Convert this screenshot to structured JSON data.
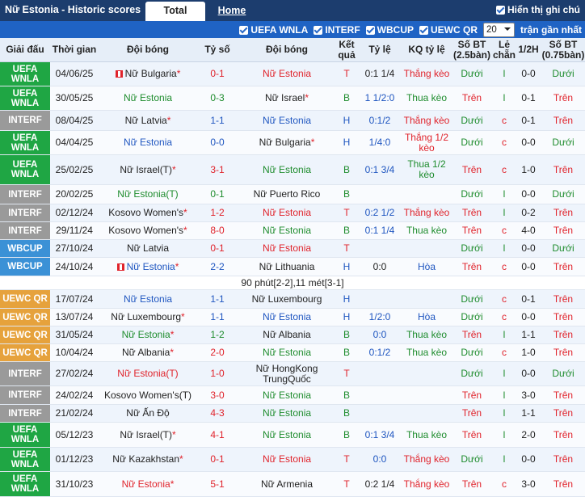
{
  "header": {
    "title": "Nữ Estonia - Historic scores",
    "tab_total": "Total",
    "tab_home": "Home",
    "show_notes_label": "Hiển thị ghi chú"
  },
  "filters": {
    "items": [
      "UEFA WNLA",
      "INTERF",
      "WBCUP",
      "UEWC QR"
    ],
    "count_value": "20",
    "recent_label": "trận gần nhất"
  },
  "columns": [
    "Giải đấu",
    "Thời gian",
    "Đội bóng",
    "Tỷ số",
    "Đội bóng",
    "Kết quả",
    "Tỷ lệ",
    "KQ tỷ lệ",
    "Số BT (2.5bàn)",
    "Lẻ chẵn",
    "1/2H",
    "Số BT (0.75bàn)"
  ],
  "colors": {
    "win": "#e0232b",
    "draw": "#1f56c0",
    "lose": "#1e8c2d",
    "uefa": "#1fa644",
    "interf": "#9a9a9a",
    "wbcup": "#3b91d6",
    "uewc": "#e6a23c"
  },
  "rows": [
    {
      "league": "UEFA WNLA",
      "lc": "UEFA",
      "date": "04/06/25",
      "home": "Nữ Bulgaria",
      "home_ast": "*",
      "home_flag": true,
      "hc": "",
      "score": "0-1",
      "sc": "red",
      "away": "Nữ Estonia",
      "away_ast": "",
      "away_flag": false,
      "ac": "red",
      "res": "T",
      "rc": "red",
      "hcap": "0:1 1/4",
      "hcapc": "",
      "kq": "Thắng kèo",
      "kqc": "red",
      "ou": "Dưới",
      "ouc": "green",
      "oe": "l",
      "oec": "green",
      "half": "0-0",
      "ou2": "Dưới",
      "ou2c": "green"
    },
    {
      "league": "UEFA WNLA",
      "lc": "UEFA",
      "date": "30/05/25",
      "home": "Nữ Estonia",
      "home_ast": "",
      "home_flag": false,
      "hc": "green",
      "score": "0-3",
      "sc": "green",
      "away": "Nữ Israel",
      "away_ast": "*",
      "away_flag": false,
      "ac": "",
      "res": "B",
      "rc": "green",
      "hcap": "1 1/2:0",
      "hcapc": "blue",
      "kq": "Thua kèo",
      "kqc": "green",
      "ou": "Trên",
      "ouc": "red",
      "oe": "l",
      "oec": "green",
      "half": "0-1",
      "ou2": "Trên",
      "ou2c": "red"
    },
    {
      "league": "INTERF",
      "lc": "INTERF",
      "date": "08/04/25",
      "home": "Nữ Latvia",
      "home_ast": "*",
      "home_flag": false,
      "hc": "",
      "score": "1-1",
      "sc": "blue",
      "away": "Nữ Estonia",
      "away_ast": "",
      "away_flag": false,
      "ac": "blue",
      "res": "H",
      "rc": "blue",
      "hcap": "0:1/2",
      "hcapc": "blue",
      "kq": "Thắng kèo",
      "kqc": "red",
      "ou": "Dưới",
      "ouc": "green",
      "oe": "c",
      "oec": "red",
      "half": "0-1",
      "ou2": "Trên",
      "ou2c": "red"
    },
    {
      "league": "UEFA WNLA",
      "lc": "UEFA",
      "date": "04/04/25",
      "home": "Nữ Estonia",
      "home_ast": "",
      "home_flag": false,
      "hc": "blue",
      "score": "0-0",
      "sc": "blue",
      "away": "Nữ Bulgaria",
      "away_ast": "*",
      "away_flag": false,
      "ac": "",
      "res": "H",
      "rc": "blue",
      "hcap": "1/4:0",
      "hcapc": "blue",
      "kq": "Thắng 1/2 kèo",
      "kqc": "red",
      "ou": "Dưới",
      "ouc": "green",
      "oe": "c",
      "oec": "red",
      "half": "0-0",
      "ou2": "Dưới",
      "ou2c": "green"
    },
    {
      "league": "UEFA WNLA",
      "lc": "UEFA",
      "date": "25/02/25",
      "home": "Nữ Israel(T)",
      "home_ast": "*",
      "home_flag": false,
      "hc": "",
      "score": "3-1",
      "sc": "red",
      "away": "Nữ Estonia",
      "away_ast": "",
      "away_flag": false,
      "ac": "green",
      "res": "B",
      "rc": "green",
      "hcap": "0:1 3/4",
      "hcapc": "blue",
      "kq": "Thua 1/2 kèo",
      "kqc": "green",
      "ou": "Trên",
      "ouc": "red",
      "oe": "c",
      "oec": "red",
      "half": "1-0",
      "ou2": "Trên",
      "ou2c": "red"
    },
    {
      "league": "INTERF",
      "lc": "INTERF",
      "date": "20/02/25",
      "home": "Nữ Estonia(T)",
      "home_ast": "",
      "home_flag": false,
      "hc": "green",
      "score": "0-1",
      "sc": "green",
      "away": "Nữ Puerto Rico",
      "away_ast": "",
      "away_flag": false,
      "ac": "",
      "res": "B",
      "rc": "green",
      "hcap": "",
      "hcapc": "",
      "kq": "",
      "kqc": "",
      "ou": "Dưới",
      "ouc": "green",
      "oe": "l",
      "oec": "green",
      "half": "0-0",
      "ou2": "Dưới",
      "ou2c": "green"
    },
    {
      "league": "INTERF",
      "lc": "INTERF",
      "date": "02/12/24",
      "home": "Kosovo Women's",
      "home_ast": "*",
      "home_flag": false,
      "hc": "",
      "score": "1-2",
      "sc": "red",
      "away": "Nữ Estonia",
      "away_ast": "",
      "away_flag": false,
      "ac": "red",
      "res": "T",
      "rc": "red",
      "hcap": "0:2 1/2",
      "hcapc": "blue",
      "kq": "Thắng kèo",
      "kqc": "red",
      "ou": "Trên",
      "ouc": "red",
      "oe": "l",
      "oec": "green",
      "half": "0-2",
      "ou2": "Trên",
      "ou2c": "red"
    },
    {
      "league": "INTERF",
      "lc": "INTERF",
      "date": "29/11/24",
      "home": "Kosovo Women's",
      "home_ast": "*",
      "home_flag": false,
      "hc": "",
      "score": "8-0",
      "sc": "red",
      "away": "Nữ Estonia",
      "away_ast": "",
      "away_flag": false,
      "ac": "green",
      "res": "B",
      "rc": "green",
      "hcap": "0:1 1/4",
      "hcapc": "blue",
      "kq": "Thua kèo",
      "kqc": "green",
      "ou": "Trên",
      "ouc": "red",
      "oe": "c",
      "oec": "red",
      "half": "4-0",
      "ou2": "Trên",
      "ou2c": "red"
    },
    {
      "league": "WBCUP",
      "lc": "WBCUP",
      "date": "27/10/24",
      "home": "Nữ Latvia",
      "home_ast": "",
      "home_flag": false,
      "hc": "",
      "score": "0-1",
      "sc": "red",
      "away": "Nữ Estonia",
      "away_ast": "",
      "away_flag": false,
      "ac": "red",
      "res": "T",
      "rc": "red",
      "hcap": "",
      "hcapc": "",
      "kq": "",
      "kqc": "",
      "ou": "Dưới",
      "ouc": "green",
      "oe": "l",
      "oec": "green",
      "half": "0-0",
      "ou2": "Dưới",
      "ou2c": "green"
    },
    {
      "league": "WBCUP",
      "lc": "WBCUP",
      "date": "24/10/24",
      "home": "Nữ Estonia",
      "home_ast": "*",
      "home_flag": true,
      "hc": "blue",
      "score": "2-2",
      "sc": "blue",
      "away": "Nữ Lithuania",
      "away_ast": "",
      "away_flag": false,
      "ac": "",
      "res": "H",
      "rc": "blue",
      "hcap": "0:0",
      "hcapc": "",
      "kq": "Hòa",
      "kqc": "blue",
      "ou": "Trên",
      "ouc": "red",
      "oe": "c",
      "oec": "red",
      "half": "0-0",
      "ou2": "Trên",
      "ou2c": "red"
    },
    {
      "note": "90 phút[2-2],11 mét[3-1]"
    },
    {
      "league": "UEWC QR",
      "lc": "UEWC",
      "date": "17/07/24",
      "home": "Nữ Estonia",
      "home_ast": "",
      "home_flag": false,
      "hc": "blue",
      "score": "1-1",
      "sc": "blue",
      "away": "Nữ Luxembourg",
      "away_ast": "",
      "away_flag": false,
      "ac": "",
      "res": "H",
      "rc": "blue",
      "hcap": "",
      "hcapc": "",
      "kq": "",
      "kqc": "",
      "ou": "Dưới",
      "ouc": "green",
      "oe": "c",
      "oec": "red",
      "half": "0-1",
      "ou2": "Trên",
      "ou2c": "red"
    },
    {
      "league": "UEWC QR",
      "lc": "UEWC",
      "date": "13/07/24",
      "home": "Nữ Luxembourg",
      "home_ast": "*",
      "home_flag": false,
      "hc": "",
      "score": "1-1",
      "sc": "blue",
      "away": "Nữ Estonia",
      "away_ast": "",
      "away_flag": false,
      "ac": "blue",
      "res": "H",
      "rc": "blue",
      "hcap": "1/2:0",
      "hcapc": "blue",
      "kq": "Hòa",
      "kqc": "blue",
      "ou": "Dưới",
      "ouc": "green",
      "oe": "c",
      "oec": "red",
      "half": "0-0",
      "ou2": "Trên",
      "ou2c": "red"
    },
    {
      "league": "UEWC QR",
      "lc": "UEWC",
      "date": "31/05/24",
      "home": "Nữ Estonia",
      "home_ast": "*",
      "home_flag": false,
      "hc": "green",
      "score": "1-2",
      "sc": "green",
      "away": "Nữ Albania",
      "away_ast": "",
      "away_flag": false,
      "ac": "",
      "res": "B",
      "rc": "green",
      "hcap": "0:0",
      "hcapc": "blue",
      "kq": "Thua kèo",
      "kqc": "green",
      "ou": "Trên",
      "ouc": "red",
      "oe": "l",
      "oec": "green",
      "half": "1-1",
      "ou2": "Trên",
      "ou2c": "red"
    },
    {
      "league": "UEWC QR",
      "lc": "UEWC",
      "date": "10/04/24",
      "home": "Nữ Albania",
      "home_ast": "*",
      "home_flag": false,
      "hc": "",
      "score": "2-0",
      "sc": "red",
      "away": "Nữ Estonia",
      "away_ast": "",
      "away_flag": false,
      "ac": "green",
      "res": "B",
      "rc": "green",
      "hcap": "0:1/2",
      "hcapc": "blue",
      "kq": "Thua kèo",
      "kqc": "green",
      "ou": "Dưới",
      "ouc": "green",
      "oe": "c",
      "oec": "red",
      "half": "1-0",
      "ou2": "Trên",
      "ou2c": "red"
    },
    {
      "league": "INTERF",
      "lc": "INTERF",
      "date": "27/02/24",
      "home": "Nữ Estonia(T)",
      "home_ast": "",
      "home_flag": false,
      "hc": "red",
      "score": "1-0",
      "sc": "red",
      "away": "Nữ HongKong TrungQuốc",
      "away_ast": "",
      "away_flag": false,
      "ac": "",
      "res": "T",
      "rc": "red",
      "hcap": "",
      "hcapc": "",
      "kq": "",
      "kqc": "",
      "ou": "Dưới",
      "ouc": "green",
      "oe": "l",
      "oec": "green",
      "half": "0-0",
      "ou2": "Dưới",
      "ou2c": "green"
    },
    {
      "league": "INTERF",
      "lc": "INTERF",
      "date": "24/02/24",
      "home": "Kosovo Women's(T)",
      "home_ast": "",
      "home_flag": false,
      "hc": "",
      "score": "3-0",
      "sc": "red",
      "away": "Nữ Estonia",
      "away_ast": "",
      "away_flag": false,
      "ac": "green",
      "res": "B",
      "rc": "green",
      "hcap": "",
      "hcapc": "",
      "kq": "",
      "kqc": "",
      "ou": "Trên",
      "ouc": "red",
      "oe": "l",
      "oec": "green",
      "half": "3-0",
      "ou2": "Trên",
      "ou2c": "red"
    },
    {
      "league": "INTERF",
      "lc": "INTERF",
      "date": "21/02/24",
      "home": "Nữ Ấn Độ",
      "home_ast": "",
      "home_flag": false,
      "hc": "",
      "score": "4-3",
      "sc": "red",
      "away": "Nữ Estonia",
      "away_ast": "",
      "away_flag": false,
      "ac": "green",
      "res": "B",
      "rc": "green",
      "hcap": "",
      "hcapc": "",
      "kq": "",
      "kqc": "",
      "ou": "Trên",
      "ouc": "red",
      "oe": "l",
      "oec": "green",
      "half": "1-1",
      "ou2": "Trên",
      "ou2c": "red"
    },
    {
      "league": "UEFA WNLA",
      "lc": "UEFA",
      "date": "05/12/23",
      "home": "Nữ Israel(T)",
      "home_ast": "*",
      "home_flag": false,
      "hc": "",
      "score": "4-1",
      "sc": "red",
      "away": "Nữ Estonia",
      "away_ast": "",
      "away_flag": false,
      "ac": "green",
      "res": "B",
      "rc": "green",
      "hcap": "0:1 3/4",
      "hcapc": "blue",
      "kq": "Thua kèo",
      "kqc": "green",
      "ou": "Trên",
      "ouc": "red",
      "oe": "l",
      "oec": "green",
      "half": "2-0",
      "ou2": "Trên",
      "ou2c": "red"
    },
    {
      "league": "UEFA WNLA",
      "lc": "UEFA",
      "date": "01/12/23",
      "home": "Nữ Kazakhstan",
      "home_ast": "*",
      "home_flag": false,
      "hc": "",
      "score": "0-1",
      "sc": "red",
      "away": "Nữ Estonia",
      "away_ast": "",
      "away_flag": false,
      "ac": "red",
      "res": "T",
      "rc": "red",
      "hcap": "0:0",
      "hcapc": "blue",
      "kq": "Thắng kèo",
      "kqc": "red",
      "ou": "Dưới",
      "ouc": "green",
      "oe": "l",
      "oec": "green",
      "half": "0-0",
      "ou2": "Trên",
      "ou2c": "red"
    },
    {
      "league": "UEFA WNLA",
      "lc": "UEFA",
      "date": "31/10/23",
      "home": "Nữ Estonia",
      "home_ast": "*",
      "home_flag": false,
      "hc": "red",
      "score": "5-1",
      "sc": "red",
      "away": "Nữ Armenia",
      "away_ast": "",
      "away_flag": false,
      "ac": "",
      "res": "T",
      "rc": "red",
      "hcap": "0:2 1/4",
      "hcapc": "",
      "kq": "Thắng kèo",
      "kqc": "red",
      "ou": "Trên",
      "ouc": "red",
      "oe": "c",
      "oec": "red",
      "half": "3-0",
      "ou2": "Trên",
      "ou2c": "red"
    }
  ]
}
